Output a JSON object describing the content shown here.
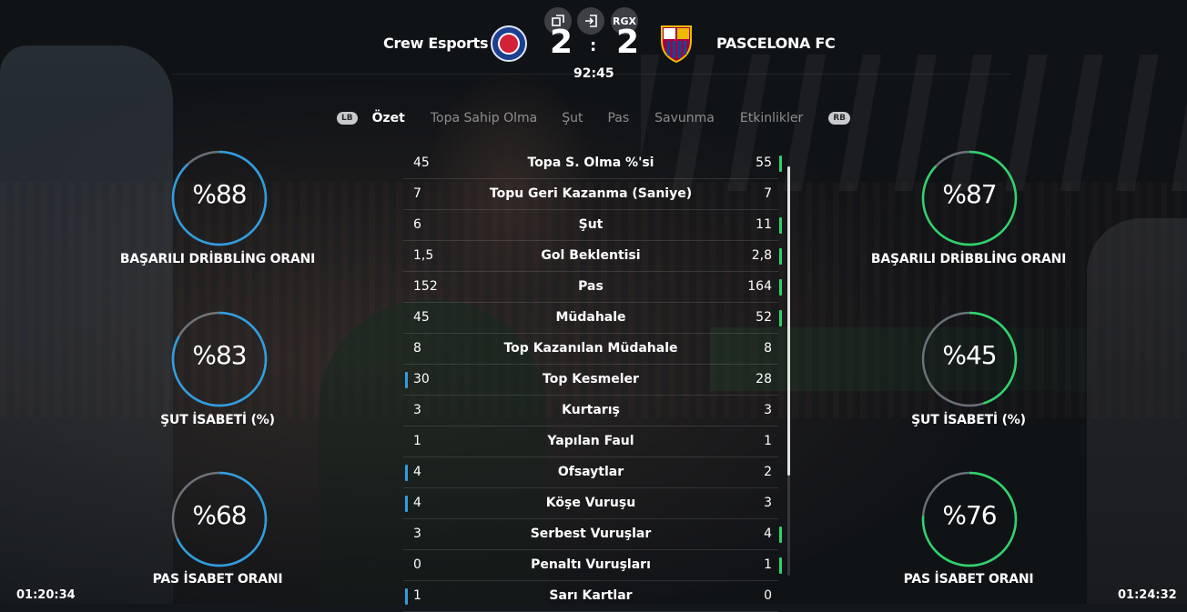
{
  "header": {
    "home_team": "Crew Esports",
    "away_team": "PASCELONA FC",
    "home_score": "2",
    "away_score": "2",
    "score_separator": ":",
    "match_time": "92:45",
    "buttons": [
      {
        "icon": "popout-icon"
      },
      {
        "icon": "exit-icon"
      },
      {
        "label": "RGX"
      }
    ]
  },
  "tabs": {
    "left_bumper": "LB",
    "right_bumper": "RB",
    "items": [
      "Özet",
      "Topa Sahip Olma",
      "Şut",
      "Pas",
      "Savunma",
      "Etkinlikler"
    ],
    "active": "Özet"
  },
  "stats": [
    {
      "name": "Topa S. Olma %'si",
      "home": "45",
      "away": "55",
      "lead": "away"
    },
    {
      "name": "Topu Geri Kazanma (Saniye)",
      "home": "7",
      "away": "7",
      "lead": "none"
    },
    {
      "name": "Şut",
      "home": "6",
      "away": "11",
      "lead": "away"
    },
    {
      "name": "Gol Beklentisi",
      "home": "1,5",
      "away": "2,8",
      "lead": "away"
    },
    {
      "name": "Pas",
      "home": "152",
      "away": "164",
      "lead": "away"
    },
    {
      "name": "Müdahale",
      "home": "45",
      "away": "52",
      "lead": "away"
    },
    {
      "name": "Top Kazanılan Müdahale",
      "home": "8",
      "away": "8",
      "lead": "none"
    },
    {
      "name": "Top Kesmeler",
      "home": "30",
      "away": "28",
      "lead": "home"
    },
    {
      "name": "Kurtarış",
      "home": "3",
      "away": "3",
      "lead": "none"
    },
    {
      "name": "Yapılan Faul",
      "home": "1",
      "away": "1",
      "lead": "none"
    },
    {
      "name": "Ofsaytlar",
      "home": "4",
      "away": "2",
      "lead": "home"
    },
    {
      "name": "Köşe Vuruşu",
      "home": "4",
      "away": "3",
      "lead": "home"
    },
    {
      "name": "Serbest Vuruşlar",
      "home": "3",
      "away": "4",
      "lead": "away"
    },
    {
      "name": "Penaltı Vuruşları",
      "home": "0",
      "away": "1",
      "lead": "away"
    },
    {
      "name": "Sarı Kartlar",
      "home": "1",
      "away": "0",
      "lead": "home"
    }
  ],
  "rings": {
    "home": [
      {
        "value": "%88",
        "fraction": 0.88,
        "label": "BAŞARILI DRİBBLİNG ORANI"
      },
      {
        "value": "%83",
        "fraction": 0.83,
        "label": "ŞUT İSABETİ (%)"
      },
      {
        "value": "%68",
        "fraction": 0.68,
        "label": "PAS İSABET ORANI"
      }
    ],
    "away": [
      {
        "value": "%87",
        "fraction": 0.87,
        "label": "BAŞARILI DRİBBLİNG ORANI"
      },
      {
        "value": "%45",
        "fraction": 0.45,
        "label": "ŞUT İSABETİ (%)"
      },
      {
        "value": "%76",
        "fraction": 0.76,
        "label": "PAS İSABET ORANI"
      }
    ]
  },
  "clocks": {
    "left": "01:20:34",
    "right": "01:24:32"
  },
  "colors": {
    "home": "#2f9ee0",
    "away": "#2fd36b",
    "track": "#8f969e"
  }
}
